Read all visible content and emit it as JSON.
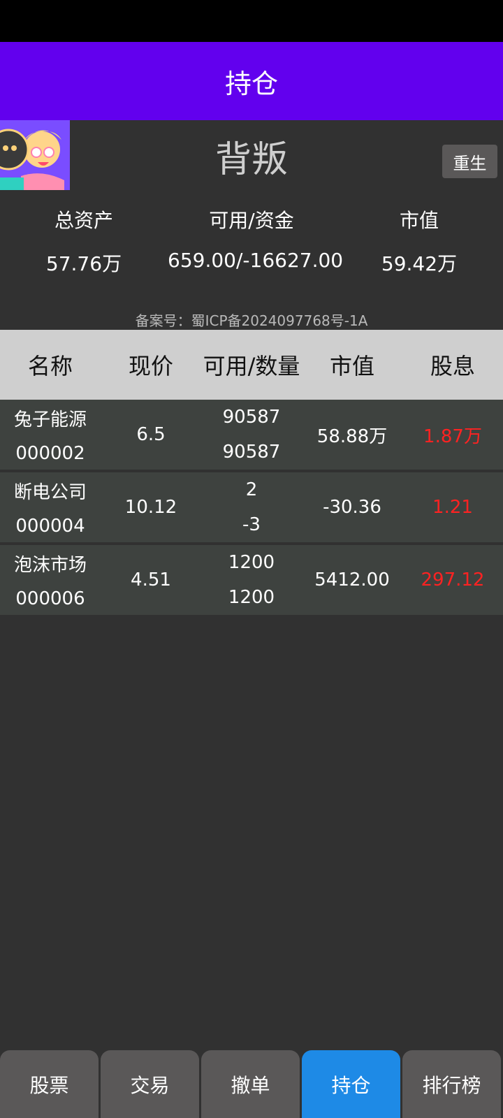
{
  "app_bar": {
    "title": "持仓"
  },
  "profile": {
    "name": "背叛",
    "reborn_label": "重生"
  },
  "stats": [
    {
      "label": "总资产",
      "value": "57.76万"
    },
    {
      "label": "可用/资金",
      "value": "659.00/-16627.00"
    },
    {
      "label": "市值",
      "value": "59.42万"
    }
  ],
  "icp": "备案号：蜀ICP备2024097768号-1A",
  "table": {
    "headers": [
      "名称",
      "现价",
      "可用/数量",
      "市值",
      "股息"
    ],
    "rows": [
      {
        "name": "兔子能源",
        "code": "000002",
        "price": "6.5",
        "available": "90587",
        "quantity": "90587",
        "market_value": "58.88万",
        "dividend": "1.87万"
      },
      {
        "name": "断电公司",
        "code": "000004",
        "price": "10.12",
        "available": "2",
        "quantity": "-3",
        "market_value": "-30.36",
        "dividend": "1.21"
      },
      {
        "name": "泡沫市场",
        "code": "000006",
        "price": "4.51",
        "available": "1200",
        "quantity": "1200",
        "market_value": "5412.00",
        "dividend": "297.12"
      }
    ]
  },
  "nav": [
    "股票",
    "交易",
    "撤单",
    "持仓",
    "排行榜"
  ],
  "colors": {
    "app_bar": "#6200ee",
    "active_tab": "#1e8ae6",
    "dividend": "#ff2222"
  }
}
